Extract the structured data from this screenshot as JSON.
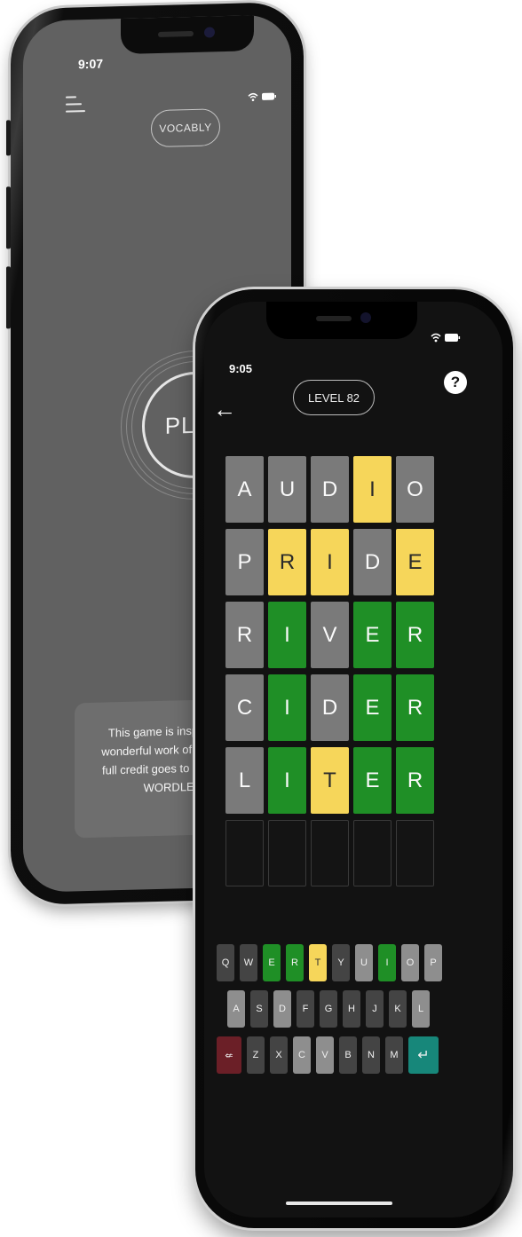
{
  "back_screen": {
    "time": "9:07",
    "status_icons": "wifi-icon battery-icon",
    "menu_icon": "menu-icon",
    "app_name": "VOCABLY",
    "play_label": "PLAY",
    "info_lines": [
      "This game is inspired by",
      "wonderful work of Josh Wa",
      "full credit goes to his amaz",
      "WORDLE."
    ]
  },
  "front_screen": {
    "time": "9:05",
    "status_icons": "wifi-icon battery-icon",
    "help_label": "?",
    "back_icon": "back-arrow-icon",
    "back_glyph": "←",
    "level_label": "LEVEL 82",
    "board": [
      {
        "letters": [
          "A",
          "U",
          "D",
          "I",
          "O"
        ],
        "states": [
          "gray",
          "gray",
          "gray",
          "yellow",
          "gray"
        ]
      },
      {
        "letters": [
          "P",
          "R",
          "I",
          "D",
          "E"
        ],
        "states": [
          "gray",
          "yellow",
          "yellow",
          "gray",
          "yellow"
        ]
      },
      {
        "letters": [
          "R",
          "I",
          "V",
          "E",
          "R"
        ],
        "states": [
          "gray",
          "green",
          "gray",
          "green",
          "green"
        ]
      },
      {
        "letters": [
          "C",
          "I",
          "D",
          "E",
          "R"
        ],
        "states": [
          "gray",
          "green",
          "gray",
          "green",
          "green"
        ]
      },
      {
        "letters": [
          "L",
          "I",
          "T",
          "E",
          "R"
        ],
        "states": [
          "gray",
          "green",
          "yellow",
          "green",
          "green"
        ]
      },
      {
        "letters": [
          "",
          "",
          "",
          "",
          ""
        ],
        "states": [
          "empty",
          "empty",
          "empty",
          "empty",
          "empty"
        ]
      }
    ],
    "keyboard": {
      "row1": [
        {
          "k": "Q",
          "s": "dark"
        },
        {
          "k": "W",
          "s": "dark"
        },
        {
          "k": "E",
          "s": "green"
        },
        {
          "k": "R",
          "s": "green"
        },
        {
          "k": "T",
          "s": "yellow"
        },
        {
          "k": "Y",
          "s": "dark"
        },
        {
          "k": "U",
          "s": "gray"
        },
        {
          "k": "I",
          "s": "green"
        },
        {
          "k": "O",
          "s": "gray"
        },
        {
          "k": "P",
          "s": "gray"
        }
      ],
      "row2": [
        {
          "k": "A",
          "s": "gray"
        },
        {
          "k": "S",
          "s": "dark"
        },
        {
          "k": "D",
          "s": "gray"
        },
        {
          "k": "F",
          "s": "dark"
        },
        {
          "k": "G",
          "s": "dark"
        },
        {
          "k": "H",
          "s": "dark"
        },
        {
          "k": "J",
          "s": "dark"
        },
        {
          "k": "K",
          "s": "dark"
        },
        {
          "k": "L",
          "s": "gray"
        }
      ],
      "row3": [
        {
          "k": "⇍",
          "s": "delete"
        },
        {
          "k": "Z",
          "s": "dark"
        },
        {
          "k": "X",
          "s": "dark"
        },
        {
          "k": "C",
          "s": "gray"
        },
        {
          "k": "V",
          "s": "gray"
        },
        {
          "k": "B",
          "s": "dark"
        },
        {
          "k": "N",
          "s": "dark"
        },
        {
          "k": "M",
          "s": "dark"
        },
        {
          "k": "↵",
          "s": "enter"
        }
      ]
    }
  },
  "colors": {
    "green": "#1f8f26",
    "yellow": "#f6d65a",
    "gray": "#7a7a7a",
    "delete": "#6b1f27",
    "enter": "#17877a"
  }
}
